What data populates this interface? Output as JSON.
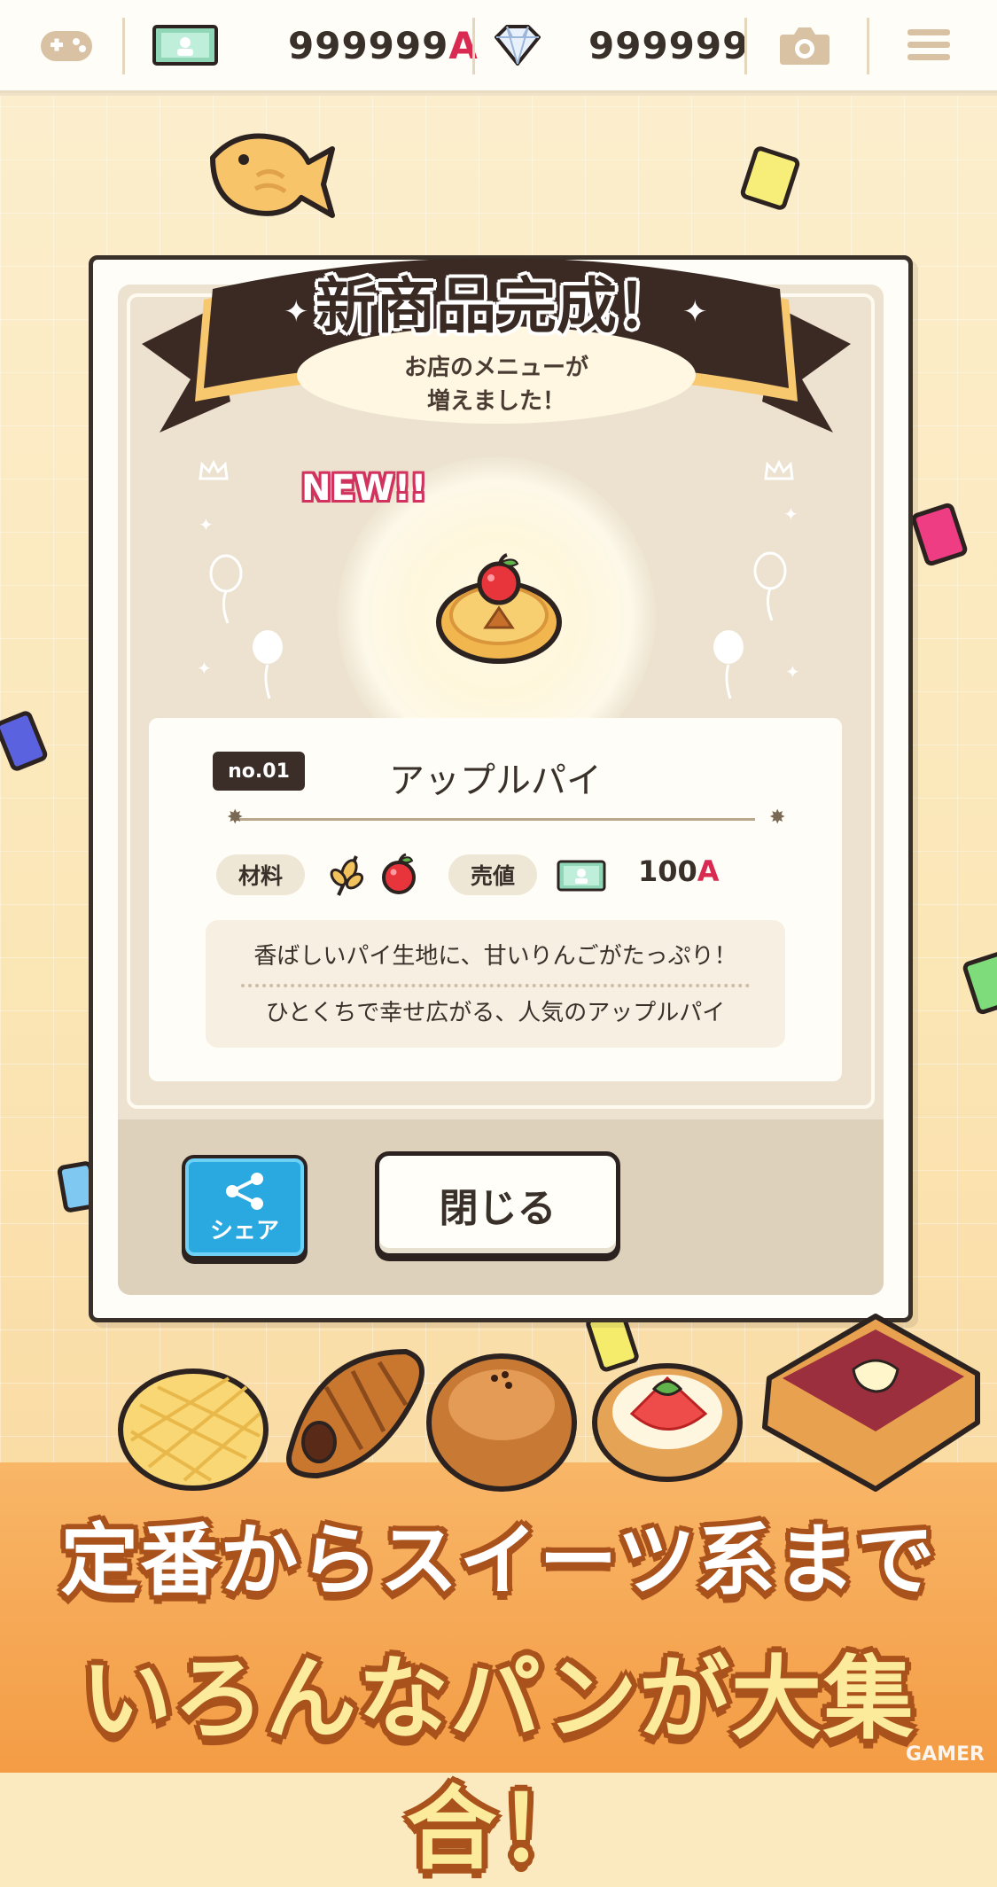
{
  "topbar": {
    "gamepad_icon": "gamepad-icon",
    "money_icon": "banknote-icon",
    "money_value": "999999",
    "money_unit": "A",
    "gem_icon": "diamond-icon",
    "gem_value": "999999",
    "camera_icon": "camera-icon",
    "menu_icon": "hamburger-menu-icon"
  },
  "modal": {
    "title": "新商品完成！",
    "subtitle_line1": "お店のメニューが",
    "subtitle_line2": "増えました！",
    "new_badge": "NEW!!",
    "item": {
      "number": "no.01",
      "name": "アップルパイ",
      "ingredients_label": "材料",
      "price_label": "売値",
      "price_value": "100",
      "price_unit": "A",
      "description_line1": "香ばしいパイ生地に、甘いりんごがたっぷり！",
      "description_line2": "ひとくちで幸せ広がる、人気のアップルパイ"
    },
    "share_label": "シェア",
    "close_label": "閉じる"
  },
  "promo": {
    "line1": "定番からスイーツ系まで",
    "line2": "いろんなパンが大集合！"
  },
  "watermark": "GAMER",
  "colors": {
    "accent_red": "#d92b52",
    "dark_brown": "#3a302a",
    "share_blue": "#2aa8e0",
    "promo_orange": "#f49c45"
  }
}
